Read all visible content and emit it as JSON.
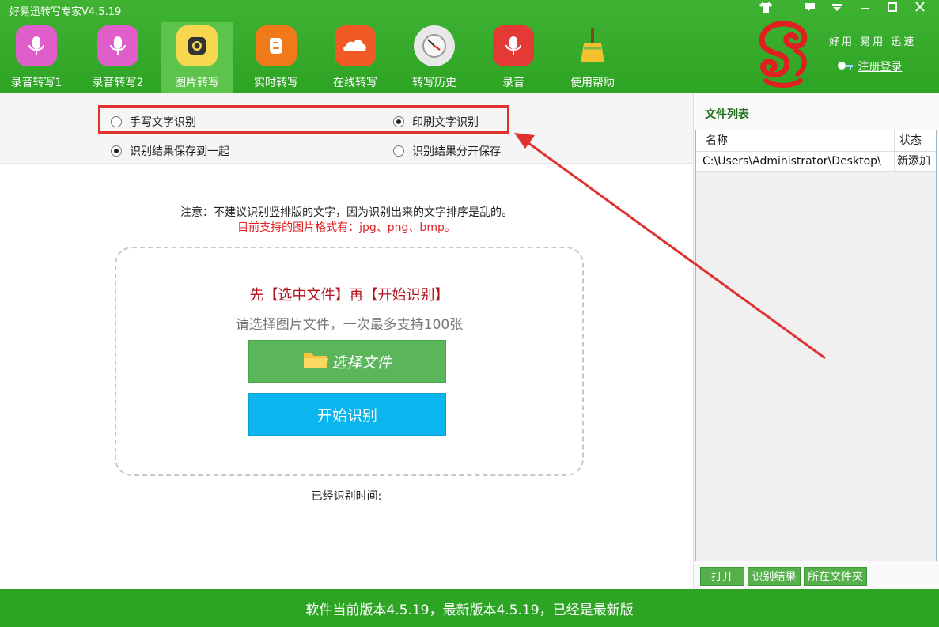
{
  "app": {
    "title": "好易迅转写专家V4.5.19"
  },
  "window_controls": [
    {
      "name": "skin-icon",
      "glyph": "👕"
    },
    {
      "name": "message-icon",
      "glyph": "▪"
    },
    {
      "name": "menu-icon",
      "glyph": "▾"
    },
    {
      "name": "minimize-icon",
      "glyph": "—"
    },
    {
      "name": "maximize-icon",
      "glyph": "□"
    },
    {
      "name": "close-icon",
      "glyph": "✕"
    }
  ],
  "toolbar": {
    "items": [
      {
        "label": "录音转写1",
        "icon": "microphone-icon",
        "color": "#e05ec9"
      },
      {
        "label": "录音转写2",
        "icon": "microphone-icon",
        "color": "#e05ec9"
      },
      {
        "label": "图片转写",
        "icon": "camera-icon",
        "color": "#f7d750",
        "active": true
      },
      {
        "label": "实时转写",
        "icon": "blogger-icon",
        "color": "#f07a1a"
      },
      {
        "label": "在线转写",
        "icon": "cloud-icon",
        "color": "#f15a24"
      },
      {
        "label": "转写历史",
        "icon": "clock-icon",
        "color": "#e8e8e8"
      },
      {
        "label": "录音",
        "icon": "mic-record-icon",
        "color": "#e53935"
      },
      {
        "label": "使用帮助",
        "icon": "broom-icon",
        "color": "#f2c12e"
      }
    ]
  },
  "brand": {
    "slogan": "好用 易用 迅速",
    "register_label": "注册登录"
  },
  "options": {
    "handwritten": "手写文字识别",
    "printed": "印刷文字识别",
    "save_together": "识别结果保存到一起",
    "save_separate": "识别结果分开保存",
    "selected_mode": "printed",
    "selected_save": "save_together"
  },
  "main": {
    "notice": "注意：不建议识别竖排版的文字，因为识别出来的文字排序是乱的。",
    "formats": "目前支持的图片格式有：jpg、png、bmp。",
    "step_text": "先【选中文件】再【开始识别】",
    "hint_text": "请选择图片文件，一次最多支持100张",
    "select_button": "选择文件",
    "start_button": "开始识别",
    "elapsed_label": "已经识别时间:"
  },
  "file_list": {
    "title": "文件列表",
    "columns": [
      "名称",
      "状态"
    ],
    "rows": [
      {
        "name": "C:\\Users\\Administrator\\Desktop\\",
        "status": "新添加"
      }
    ],
    "buttons": [
      "打开",
      "识别结果",
      "所在文件夹"
    ]
  },
  "status_bar": {
    "text": "软件当前版本4.5.19，最新版本4.5.19，已经是最新版"
  },
  "colors": {
    "header_green": "#2ea424",
    "annotation_red": "#e03131",
    "start_blue": "#0bb6ee",
    "select_green": "#5bb55a"
  }
}
